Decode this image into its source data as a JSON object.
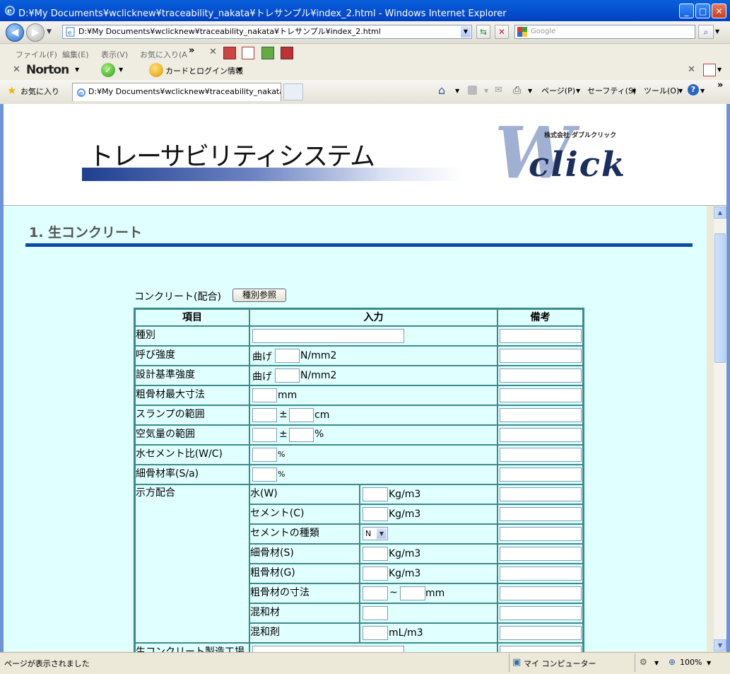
{
  "window": {
    "title": "D:¥My Documents¥wclicknew¥traceability_nakata¥トレサンプル¥index_2.html - Windows Internet Explorer",
    "minimize": "_",
    "maximize": "□",
    "close": "✕"
  },
  "address": {
    "url": "D:¥My Documents¥wclicknew¥traceability_nakata¥トレサンプル¥index_2.html",
    "search_placeholder": "Google"
  },
  "menu": [
    "ファイル(F)",
    "編集(E)",
    "表示(V)",
    "お気に入り(A"
  ],
  "toolbar2": {
    "norton": "Norton",
    "card_login": "カードとログイン情報"
  },
  "favorites": {
    "label": "お気に入り",
    "tab_title": "D:¥My Documents¥wclicknew¥traceability_nakata¥...",
    "tools": [
      "ページ(P)",
      "セーフティ(S)",
      "ツール(O)"
    ]
  },
  "header": {
    "system_title": "トレーサビリティシステム",
    "company": "株式会社 ダブルクリック",
    "logo_w": "W",
    "logo_text": "click"
  },
  "section": {
    "title": "1. 生コンクリート",
    "mix_label": "コンクリート(配合)",
    "ref_button": "種別参照"
  },
  "table": {
    "headers": [
      "項目",
      "入力",
      "備考"
    ],
    "rows": {
      "kind": "種別",
      "strength": "呼び強度",
      "design": "設計基準強度",
      "max_agg": "粗骨材最大寸法",
      "slump": "スランプの範囲",
      "air": "空気量の範囲",
      "wc": "水セメント比(W/C)",
      "sa": "細骨材率(S/a)",
      "mix": "示方配合",
      "plant": "生コンクリート製造工場"
    },
    "units": {
      "bend": "曲げ",
      "nmm2": "N/mm2",
      "mm": "mm",
      "pm": "±",
      "cm": "cm",
      "pct": "%",
      "kgm3": "Kg/m3",
      "tilde": "~",
      "mlm3": "mL/m3"
    },
    "mix_items": {
      "water": "水(W)",
      "cement": "セメント(C)",
      "cement_type": "セメントの種類",
      "fine": "細骨材(S)",
      "coarse": "粗骨材(G)",
      "coarse_size": "粗骨材の寸法",
      "admixture": "混和材",
      "agent": "混和剤"
    },
    "cement_type_value": "N"
  },
  "status": {
    "left": "ページが表示されました",
    "zone": "マイ コンピューター",
    "zoom": "100%"
  }
}
